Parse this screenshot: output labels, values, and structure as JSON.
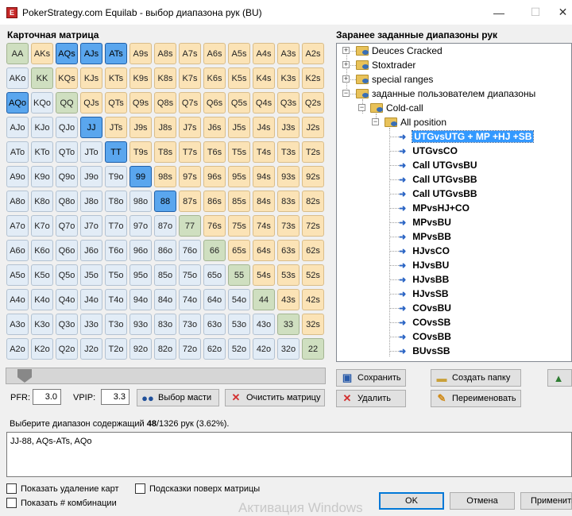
{
  "window": {
    "title": "PokerStrategy.com Equilab - выбор диапазона рук (BU)",
    "app_icon": "E"
  },
  "left_title": "Карточная матрица",
  "right_title": "Заранее заданные диапазоны рук",
  "matrix": [
    [
      "AA",
      "AKs",
      "AQs",
      "AJs",
      "ATs",
      "A9s",
      "A8s",
      "A7s",
      "A6s",
      "A5s",
      "A4s",
      "A3s",
      "A2s"
    ],
    [
      "AKo",
      "KK",
      "KQs",
      "KJs",
      "KTs",
      "K9s",
      "K8s",
      "K7s",
      "K6s",
      "K5s",
      "K4s",
      "K3s",
      "K2s"
    ],
    [
      "AQo",
      "KQo",
      "QQ",
      "QJs",
      "QTs",
      "Q9s",
      "Q8s",
      "Q7s",
      "Q6s",
      "Q5s",
      "Q4s",
      "Q3s",
      "Q2s"
    ],
    [
      "AJo",
      "KJo",
      "QJo",
      "JJ",
      "JTs",
      "J9s",
      "J8s",
      "J7s",
      "J6s",
      "J5s",
      "J4s",
      "J3s",
      "J2s"
    ],
    [
      "ATo",
      "KTo",
      "QTo",
      "JTo",
      "TT",
      "T9s",
      "T8s",
      "T7s",
      "T6s",
      "T5s",
      "T4s",
      "T3s",
      "T2s"
    ],
    [
      "A9o",
      "K9o",
      "Q9o",
      "J9o",
      "T9o",
      "99",
      "98s",
      "97s",
      "96s",
      "95s",
      "94s",
      "93s",
      "92s"
    ],
    [
      "A8o",
      "K8o",
      "Q8o",
      "J8o",
      "T8o",
      "98o",
      "88",
      "87s",
      "86s",
      "85s",
      "84s",
      "83s",
      "82s"
    ],
    [
      "A7o",
      "K7o",
      "Q7o",
      "J7o",
      "T7o",
      "97o",
      "87o",
      "77",
      "76s",
      "75s",
      "74s",
      "73s",
      "72s"
    ],
    [
      "A6o",
      "K6o",
      "Q6o",
      "J6o",
      "T6o",
      "96o",
      "86o",
      "76o",
      "66",
      "65s",
      "64s",
      "63s",
      "62s"
    ],
    [
      "A5o",
      "K5o",
      "Q5o",
      "J5o",
      "T5o",
      "95o",
      "85o",
      "75o",
      "65o",
      "55",
      "54s",
      "53s",
      "52s"
    ],
    [
      "A4o",
      "K4o",
      "Q4o",
      "J4o",
      "T4o",
      "94o",
      "84o",
      "74o",
      "64o",
      "54o",
      "44",
      "43s",
      "42s"
    ],
    [
      "A3o",
      "K3o",
      "Q3o",
      "J3o",
      "T3o",
      "93o",
      "83o",
      "73o",
      "63o",
      "53o",
      "43o",
      "33",
      "32s"
    ],
    [
      "A2o",
      "K2o",
      "Q2o",
      "J2o",
      "T2o",
      "92o",
      "82o",
      "72o",
      "62o",
      "52o",
      "42o",
      "32o",
      "22"
    ]
  ],
  "selected_hands": [
    "AQs",
    "AJs",
    "ATs",
    "AQo",
    "JJ",
    "TT",
    "99",
    "88"
  ],
  "colors": {
    "suited": "#fbe3b6",
    "offsuit": "#e2ecf6",
    "pair": "#cfdfc0",
    "selected": "#5aa6ee"
  },
  "slider": {
    "value_percent": 3.62
  },
  "pfr": {
    "label": "PFR:",
    "value": "3.0"
  },
  "vpip": {
    "label": "VPIP:",
    "value": "3.3"
  },
  "buttons": {
    "suit_select": "Выбор масти",
    "clear_matrix": "Очистить матрицу",
    "save": "Сохранить",
    "create_folder": "Создать папку",
    "delete": "Удалить",
    "rename": "Переименовать"
  },
  "status": {
    "prefix": "Выберите диапазон содержащий ",
    "count": "48",
    "suffix": "/1326 рук (3.62%)."
  },
  "range_text": "JJ-88, AQs-ATs, AQo",
  "checkboxes": {
    "show_removal": "Показать удаление карт",
    "hints_over": "Подсказки поверх матрицы",
    "show_combos": "Показать # комбинации"
  },
  "watermark": "Активация Windows",
  "dialog": {
    "ok": "OK",
    "cancel": "Отмена",
    "apply": "Применить"
  },
  "tree": {
    "roots": [
      "Deuces Cracked",
      "Stoxtrader",
      "special ranges",
      "заданные пользователем диапазоны"
    ],
    "cold_call": "Cold-call",
    "all_position": "All position",
    "leaves": [
      "UTGvsUTG + MP +HJ +SB",
      "UTGvsCO",
      "Call UTGvsBU",
      "Call UTGvsBB",
      "Call UTGvsBB",
      "MPvsHJ+CO",
      "MPvsBU",
      "MPvsBB",
      "HJvsCO",
      "HJvsBU",
      "HJvsBB",
      "HJvsSB",
      "COvsBU",
      "COvsSB",
      "COvsBB",
      "BUvsSB"
    ]
  }
}
